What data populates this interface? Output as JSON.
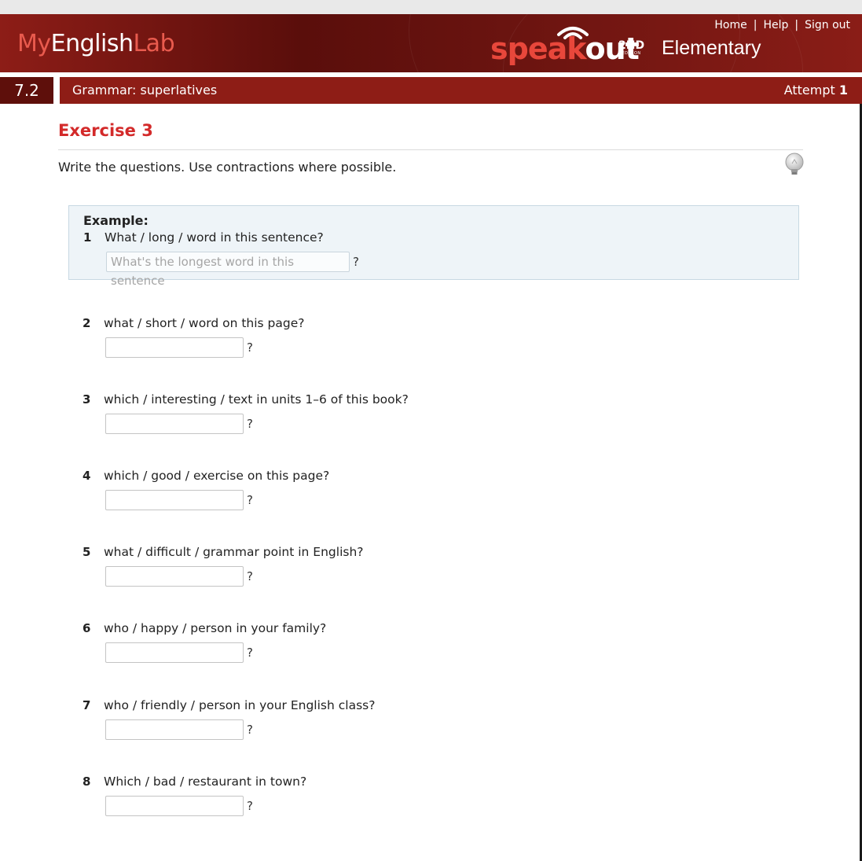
{
  "brand": {
    "my": "My",
    "english": "English",
    "lab": "Lab",
    "product_speak": "speak",
    "product_out": "out",
    "edition_main": "2ND",
    "edition_small": "EDITION",
    "level": "Elementary"
  },
  "toplinks": {
    "home": "Home",
    "help": "Help",
    "signout": "Sign out",
    "separator": "|"
  },
  "subbar": {
    "unit": "7.2",
    "title": "Grammar: superlatives",
    "attempt_label": "Attempt",
    "attempt_number": "1"
  },
  "exercise": {
    "title": "Exercise 3",
    "instructions": "Write the questions. Use contractions where possible.",
    "example_label": "Example:",
    "example": {
      "number": "1",
      "prompt": "What / long / word in this sentence?",
      "answer": "What's the longest word in this sentence"
    },
    "question_mark": "?",
    "questions": [
      {
        "number": "2",
        "prompt": "what / short / word on this page?",
        "answer": ""
      },
      {
        "number": "3",
        "prompt": "which / interesting / text in units 1–6 of this book?",
        "answer": ""
      },
      {
        "number": "4",
        "prompt": "which / good / exercise on this page?",
        "answer": ""
      },
      {
        "number": "5",
        "prompt": "what / difficult / grammar point in English?",
        "answer": ""
      },
      {
        "number": "6",
        "prompt": "who / happy / person in your family?",
        "answer": ""
      },
      {
        "number": "7",
        "prompt": "who / friendly / person in your English class?",
        "answer": ""
      },
      {
        "number": "8",
        "prompt": "Which / bad / restaurant in town?",
        "answer": ""
      }
    ]
  },
  "colors": {
    "header_dark": "#5a0e0b",
    "header_red": "#8e1d16",
    "exercise_title": "#d32a2a",
    "example_bg": "#eef4f8"
  }
}
